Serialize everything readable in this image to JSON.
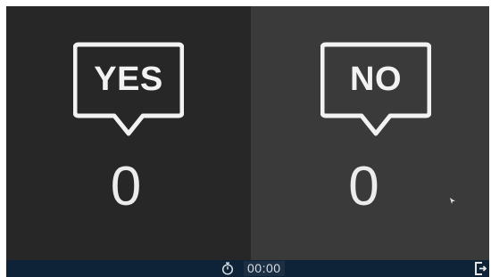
{
  "poll": {
    "yes": {
      "label": "YES",
      "count": "0"
    },
    "no": {
      "label": "NO",
      "count": "0"
    }
  },
  "footer": {
    "timer": "00:00",
    "timer_icon": "stopwatch-icon",
    "exit_icon": "exit-icon"
  },
  "colors": {
    "yes_panel": "#272727",
    "no_panel": "#3a3a3a",
    "footer_bar": "#0e2238",
    "foreground": "#f2f2f2"
  }
}
